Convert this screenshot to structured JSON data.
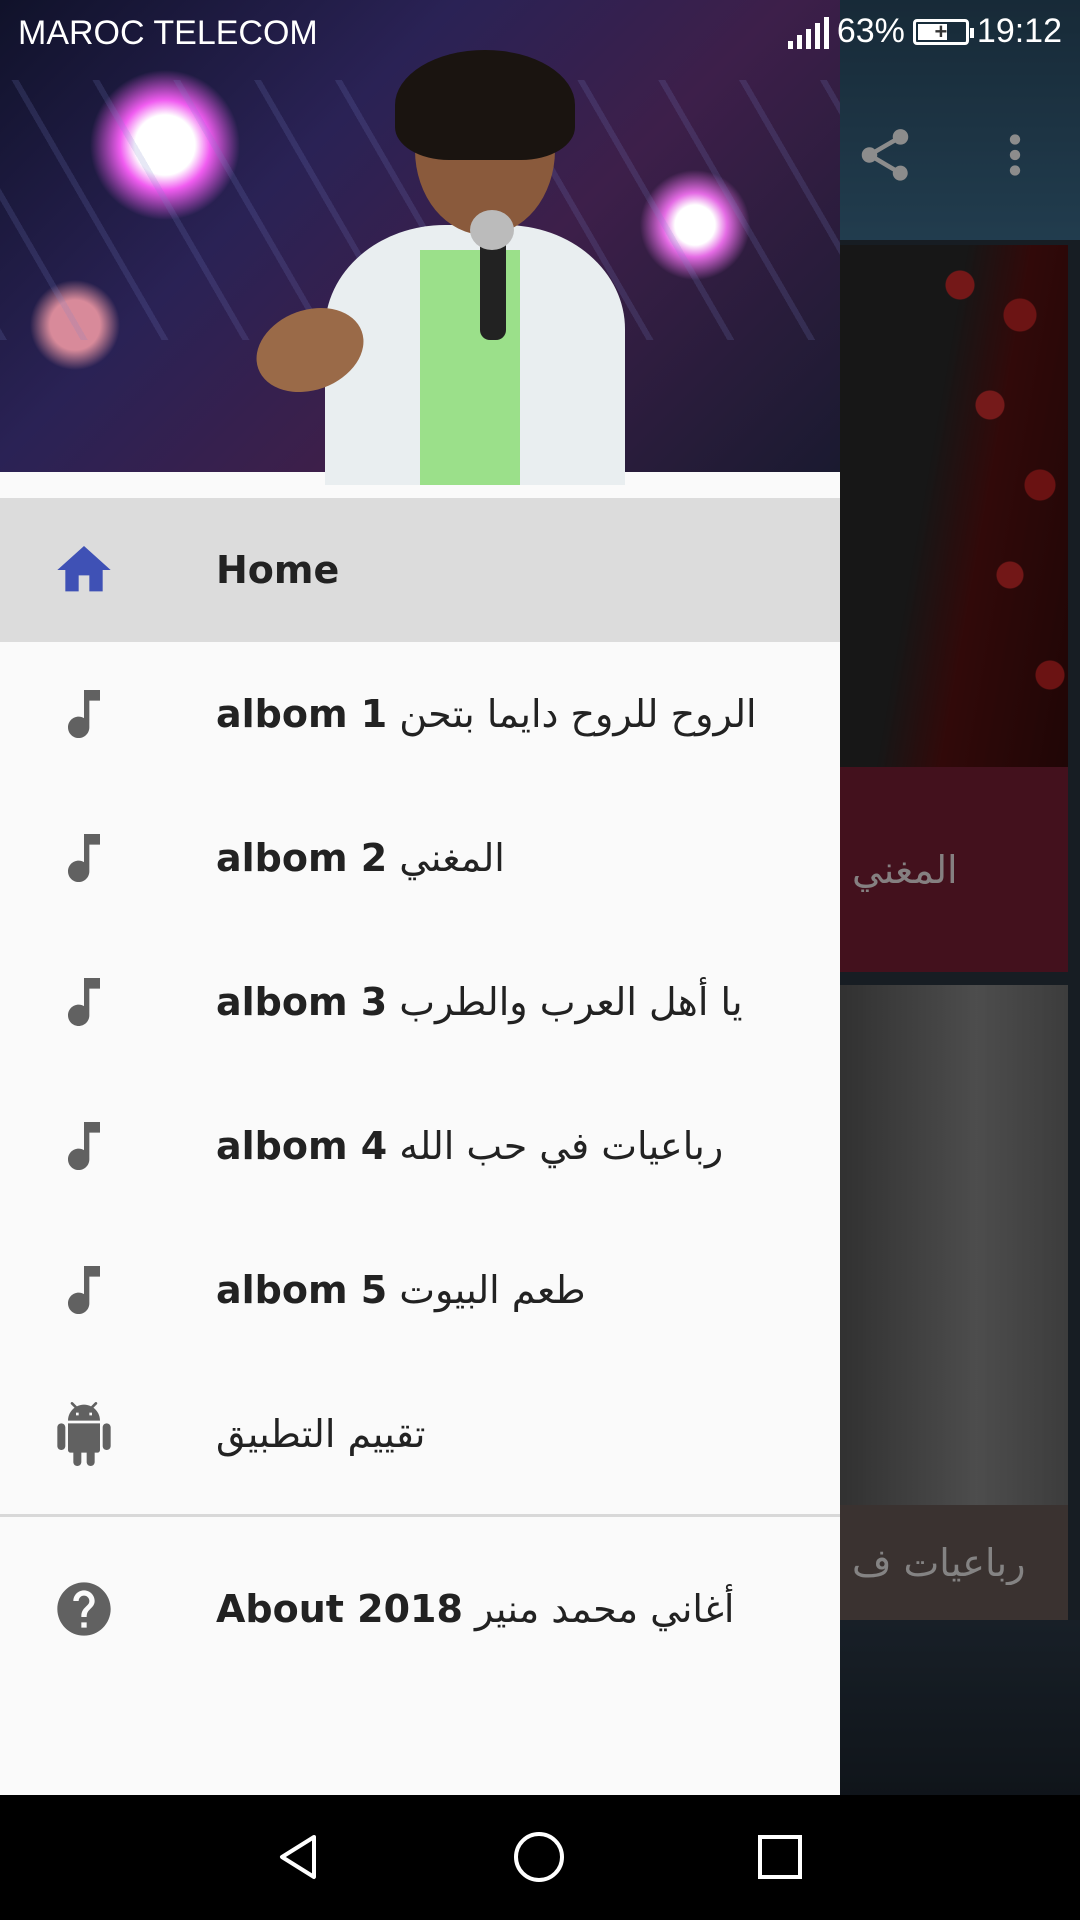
{
  "status_bar": {
    "carrier": "MAROC TELECOM",
    "battery_percent": "63%",
    "battery_level": 0.63,
    "time": "19:12"
  },
  "background_app": {
    "toolbar_icons": [
      "share-icon",
      "more-vert-icon"
    ],
    "card_1_text": "المغني",
    "card_2_text": "رباعيات ف"
  },
  "drawer": {
    "menu": [
      {
        "icon": "home-icon",
        "bold": "Home",
        "text": "",
        "selected": true
      },
      {
        "icon": "music-note-icon",
        "bold": "albom 1",
        "text": "الروح للروح دايما بتحن"
      },
      {
        "icon": "music-note-icon",
        "bold": "albom 2",
        "text": "المغني"
      },
      {
        "icon": "music-note-icon",
        "bold": "albom 3",
        "text": "يا أهل العرب والطرب"
      },
      {
        "icon": "music-note-icon",
        "bold": "albom 4",
        "text": "رباعيات في حب الله"
      },
      {
        "icon": "music-note-icon",
        "bold": "albom 5",
        "text": "طعم البيوت"
      },
      {
        "icon": "android-icon",
        "bold": "",
        "text": "تقييم التطبيق"
      }
    ],
    "secondary": [
      {
        "icon": "help-icon",
        "bold": "About 2018",
        "text": "أغاني محمد منير"
      }
    ]
  },
  "colors": {
    "accent": "#3f51b5",
    "icon_gray": "#616161",
    "selected_bg": "#dcdcdc"
  },
  "nav_bar": {
    "buttons": [
      "back-icon",
      "home-circle-icon",
      "recents-icon"
    ]
  }
}
